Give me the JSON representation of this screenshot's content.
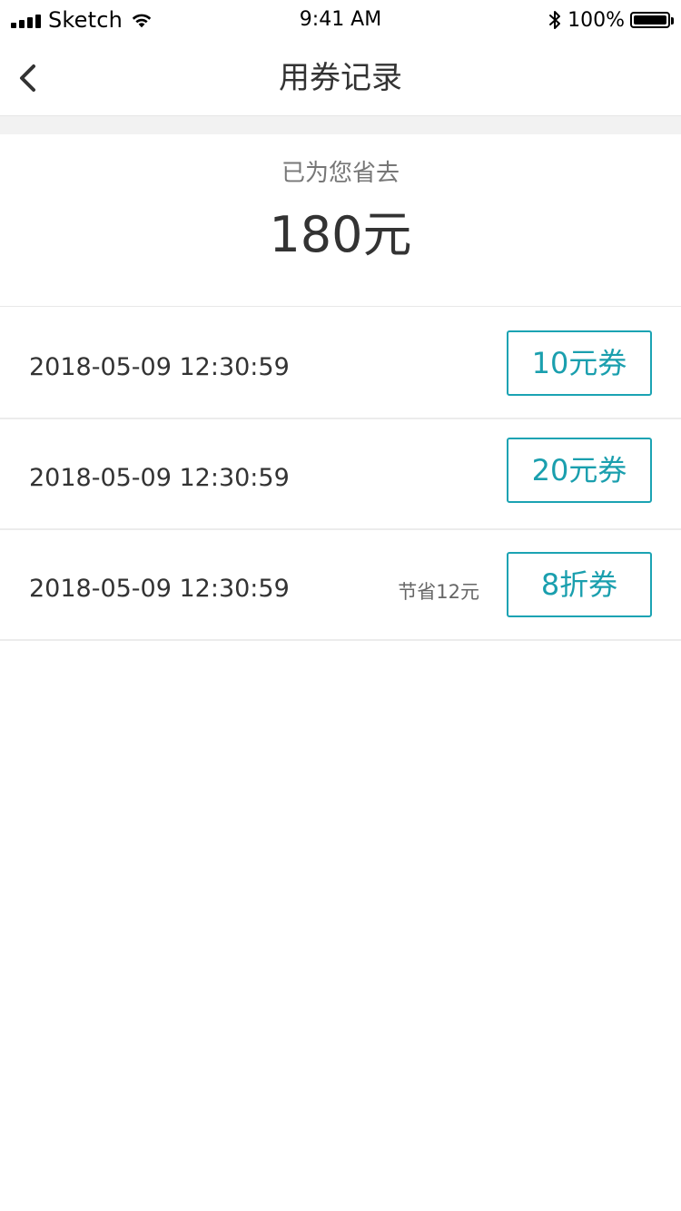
{
  "status_bar": {
    "carrier": "Sketch",
    "time": "9:41 AM",
    "battery_percent": "100%",
    "signal_icon": "cellular-signal-icon",
    "wifi_icon": "wifi-icon",
    "bluetooth_icon": "bluetooth-icon",
    "battery_icon": "battery-full-icon"
  },
  "header": {
    "title": "用券记录",
    "back_icon": "chevron-left-icon"
  },
  "summary": {
    "label": "已为您省去",
    "amount": "180元"
  },
  "records": [
    {
      "datetime": "2018-05-09 12:30:59",
      "saving": "",
      "coupon": "10元券"
    },
    {
      "datetime": "2018-05-09 12:30:59",
      "saving": "",
      "coupon": "20元券"
    },
    {
      "datetime": "2018-05-09 12:30:59",
      "saving": "节省12元",
      "coupon": "8折券"
    }
  ],
  "colors": {
    "accent": "#1a9fae",
    "text_primary": "#333333",
    "text_secondary": "#777777",
    "divider": "#ececec",
    "band": "#f2f2f2"
  }
}
